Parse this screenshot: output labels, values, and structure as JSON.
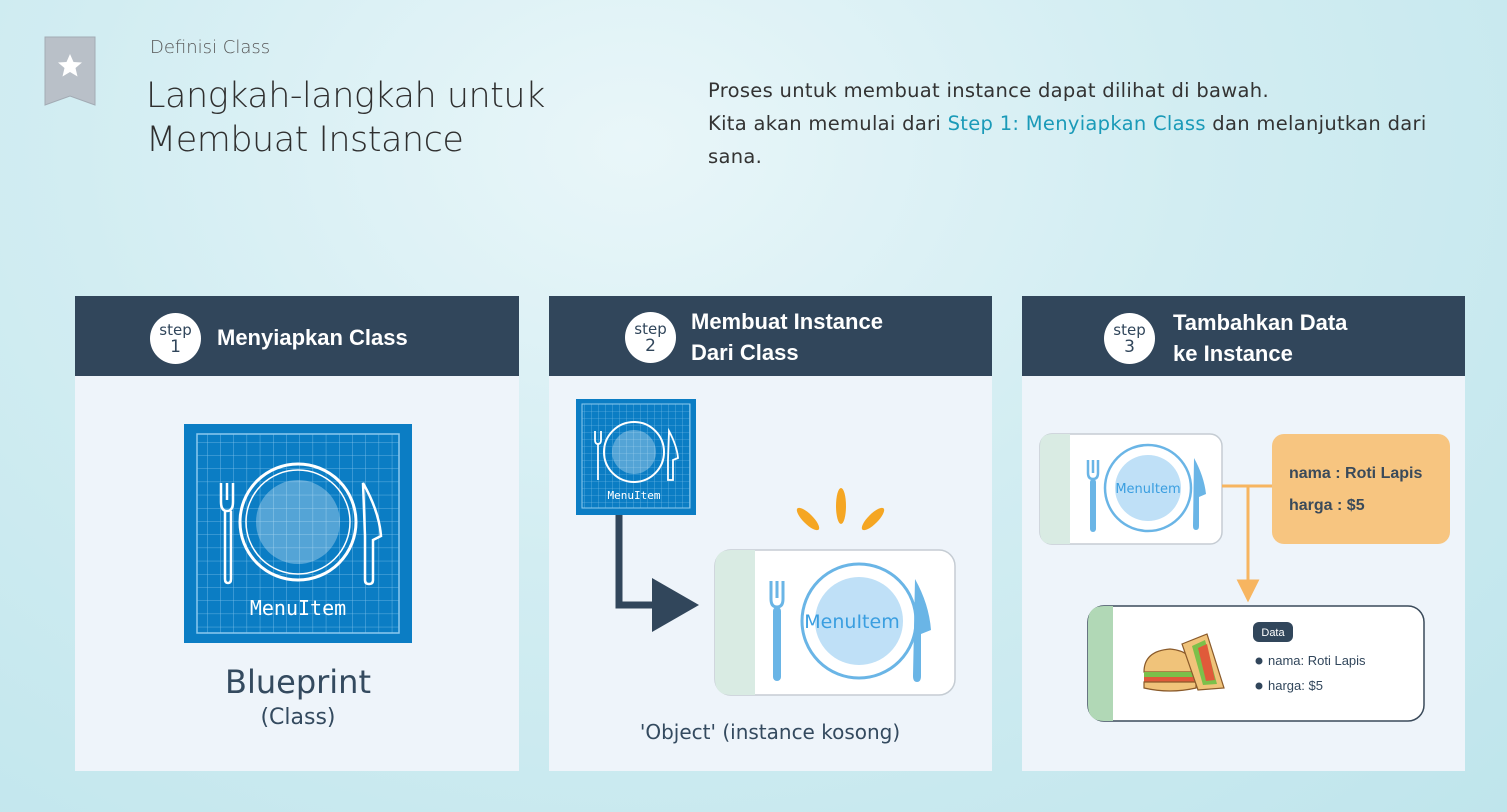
{
  "header": {
    "breadcrumb": "Definisi Class",
    "title_line1": "Langkah-langkah untuk",
    "title_line2": "Membuat Instance"
  },
  "intro": {
    "line1": "Proses untuk membuat instance dapat dilihat di bawah.",
    "line2_prefix": "Kita akan memulai dari ",
    "line2_link": "Step 1: Menyiapkan Class",
    "line2_suffix": " dan melanjutkan dari sana."
  },
  "steps": [
    {
      "badge_word": "step",
      "badge_number": "1",
      "title_line1": "Menyiapkan Class",
      "blueprint_label": "MenuItem",
      "caption_main": "Blueprint",
      "caption_sub": "(Class)"
    },
    {
      "badge_word": "step",
      "badge_number": "2",
      "title_line1": "Membuat Instance",
      "title_line2": "Dari Class",
      "blueprint_label": "MenuItem",
      "object_label": "MenuItem",
      "caption": "'Object'  (instance kosong)"
    },
    {
      "badge_word": "step",
      "badge_number": "3",
      "title_line1": "Tambahkan Data",
      "title_line2": "ke Instance",
      "object_label": "MenuItem",
      "data_line1": "nama : Roti Lapis",
      "data_line2": "harga : $5",
      "data_tag": "Data",
      "bullet1": "nama: Roti Lapis",
      "bullet2": "harga: $5"
    }
  ],
  "colors": {
    "header_bg": "#31465b",
    "card_bg": "#eef4fa",
    "blueprint_blue": "#0b7dc4",
    "accent_orange": "#f7c580",
    "link": "#1a9ab8",
    "sparkle": "#f5a623"
  }
}
